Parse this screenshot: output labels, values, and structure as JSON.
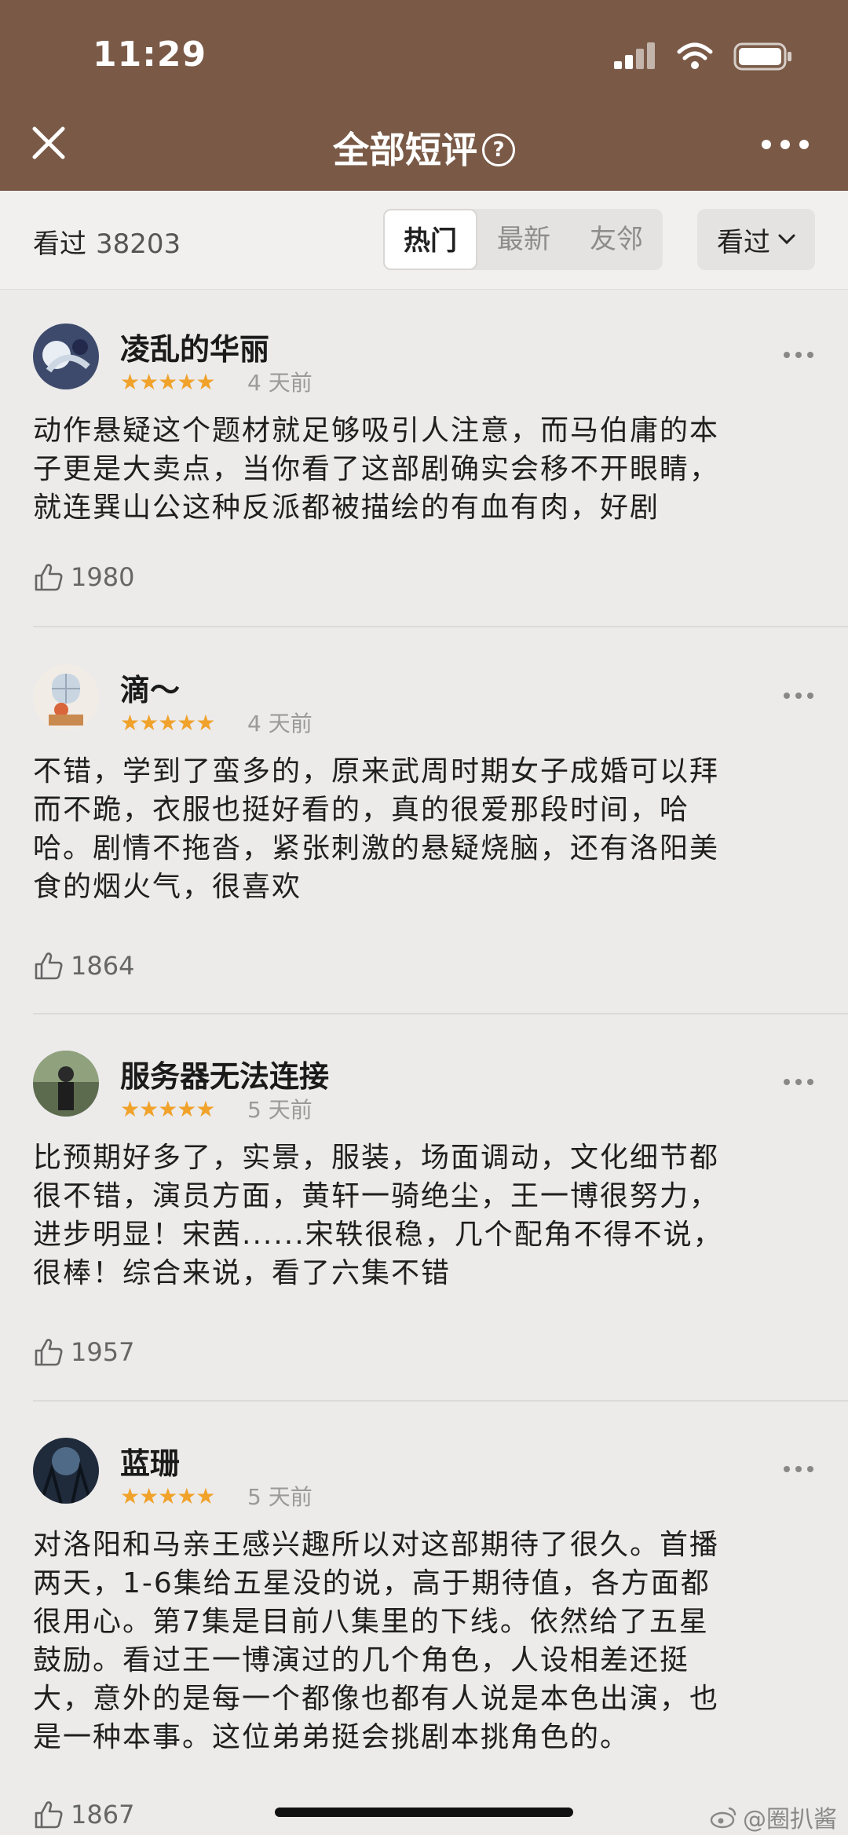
{
  "status_bar": {
    "time": "11:29"
  },
  "nav": {
    "title": "全部短评",
    "help_symbol": "?"
  },
  "filter": {
    "seen_label": "看过",
    "seen_count": "38203",
    "tabs": [
      {
        "label": "热门",
        "active": true
      },
      {
        "label": "最新",
        "active": false
      },
      {
        "label": "友邻",
        "active": false
      }
    ],
    "dropdown_value": "看过"
  },
  "reviews": [
    {
      "username": "凌乱的华丽",
      "stars": "★★★★★",
      "rating": 5,
      "date": "4 天前",
      "lines": [
        "动作悬疑这个题材就足够吸引人注意，而马伯庸的本",
        "子更是大卖点，当你看了这部剧确实会移不开眼睛，",
        "就连巽山公这种反派都被描绘的有血有肉，好剧"
      ],
      "likes": "1980"
    },
    {
      "username": "滴～",
      "stars": "★★★★★",
      "rating": 5,
      "date": "4 天前",
      "lines": [
        "不错，学到了蛮多的，原来武周时期女子成婚可以拜",
        "而不跪，衣服也挺好看的，真的很爱那段时间，哈",
        "哈。剧情不拖沓，紧张刺激的悬疑烧脑，还有洛阳美",
        "食的烟火气，很喜欢"
      ],
      "likes": "1864"
    },
    {
      "username": "服务器无法连接",
      "stars": "★★★★★",
      "rating": 5,
      "date": "5 天前",
      "lines": [
        "比预期好多了，实景，服装，场面调动，文化细节都",
        "很不错，演员方面，黄轩一骑绝尘，王一博很努力，",
        "进步明显！宋茜......宋轶很稳，几个配角不得不说，",
        "很棒！综合来说，看了六集不错"
      ],
      "likes": "1957"
    },
    {
      "username": "蓝珊",
      "stars": "★★★★★",
      "rating": 5,
      "date": "5 天前",
      "lines": [
        "对洛阳和马亲王感兴趣所以对这部期待了很久。首播",
        "两天，1-6集给五星没的说，高于期待值，各方面都",
        "很用心。第7集是目前八集里的下线。依然给了五星",
        "鼓励。看过王一博演过的几个角色，人设相差还挺",
        "大，意外的是每一个都像也都有人说是本色出演，也",
        "是一种本事。这位弟弟挺会挑剧本挑角色的。"
      ],
      "likes": "1867"
    }
  ],
  "watermark": "@圈扒酱",
  "colors": {
    "header": "#7a5a47",
    "star": "#f0a22b",
    "background": "#ecebea"
  }
}
